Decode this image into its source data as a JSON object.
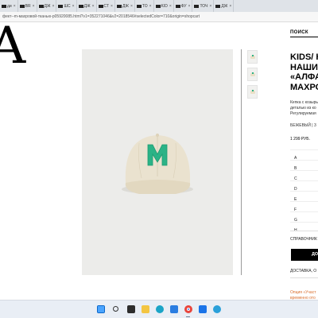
{
  "browser": {
    "tabs": [
      {
        "label": "ди"
      },
      {
        "label": "BR"
      },
      {
        "label": "ДЖ"
      },
      {
        "label": "ШС"
      },
      {
        "label": "ДЖ"
      },
      {
        "label": "СТ"
      },
      {
        "label": "ДЖ"
      },
      {
        "label": "ТО"
      },
      {
        "label": "KID"
      },
      {
        "label": "ФУ"
      },
      {
        "label": "ТОЧ"
      },
      {
        "label": "ДЖ"
      }
    ],
    "url": "фект--m-махровой-тканью-p05920085.html?v1=352271046&v2=2018546#selectedColor=710&origin=shopcart"
  },
  "site": {
    "logo_text": "A",
    "search_label": "ПОИСК"
  },
  "product": {
    "title_lines": [
      "KIDS/ К",
      "НАШИІ",
      "«АЛФА",
      "МАХРО"
    ],
    "description_lines": [
      "Кепка с козырь",
      "деталью из ко",
      "Регулируемая"
    ],
    "color": "БЕЖЕВЫЙ | 3",
    "price": "1 299 РУБ.",
    "sizes": [
      "A",
      "B",
      "C",
      "D",
      "E",
      "F",
      "G",
      "H"
    ],
    "reference_label": "СПРАВОЧНИК",
    "add_button": "ДО",
    "delivery": "ДОСТАВКА, О",
    "note_lines": [
      "Опция «Участ",
      "временно ото"
    ]
  },
  "colors": {
    "accent_green": "#2bb386",
    "note_orange": "#d96c2a"
  }
}
